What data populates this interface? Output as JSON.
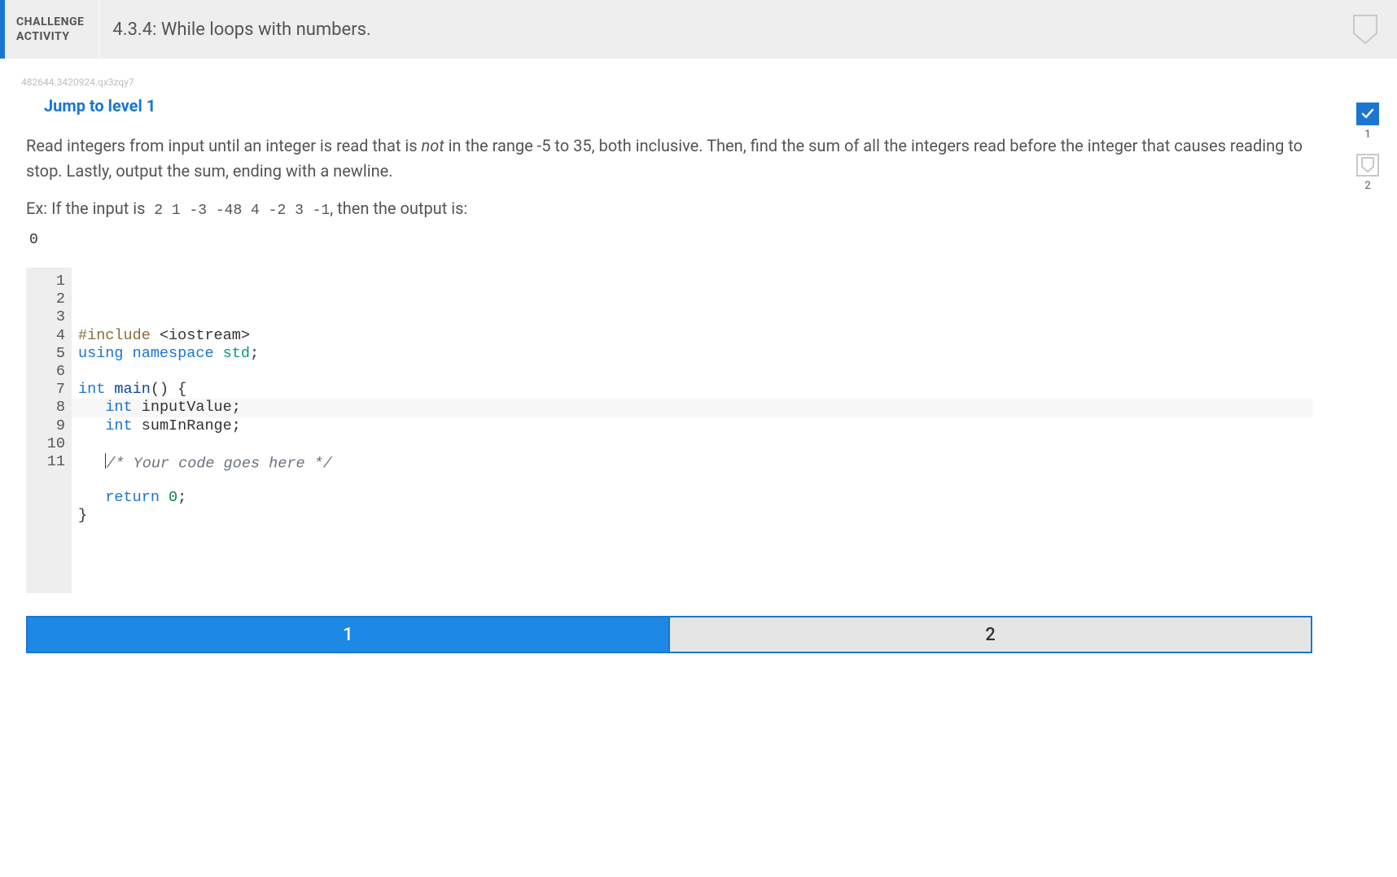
{
  "header": {
    "tag_line1": "CHALLENGE",
    "tag_line2": "ACTIVITY",
    "title": "4.3.4: While loops with numbers."
  },
  "id_string": "482644.3420924.qx3zqy7",
  "jump_label": "Jump to level 1",
  "problem": {
    "para1_pre": "Read integers from input until an integer is read that is ",
    "para1_not": "not",
    "para1_post": " in the range -5 to 35, both inclusive. Then, find the sum of all the integers read before the integer that causes reading to stop. Lastly, output the sum, ending with a newline.",
    "example_prefix": "Ex: If the input is",
    "example_input": " 2 1 -3 -48 4 -2 3 -1",
    "example_suffix": ", then the output is:",
    "example_output": "0"
  },
  "code": {
    "lines": [
      "#include <iostream>",
      "using namespace std;",
      "",
      "int main() {",
      "   int inputValue;",
      "   int sumInRange;",
      "",
      "   /* Your code goes here */",
      "",
      "   return 0;",
      "}"
    ]
  },
  "levels": {
    "l1": "1",
    "l2": "2"
  },
  "progress": {
    "seg1": "1",
    "seg2": "2"
  }
}
